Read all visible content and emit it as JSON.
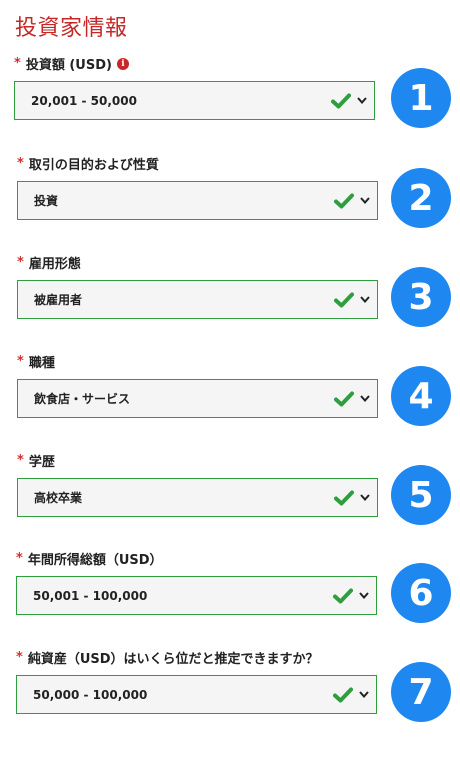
{
  "title": "投資家情報",
  "required_mark": "*",
  "info_glyph": "i",
  "fields": [
    {
      "label": "投資額 (USD)",
      "value": "20,001 - 50,000",
      "step": "1",
      "has_info": true
    },
    {
      "label": "取引の目的および性質",
      "value": "投資",
      "step": "2"
    },
    {
      "label": "雇用形態",
      "value": "被雇用者",
      "step": "3"
    },
    {
      "label": "職種",
      "value": "飲食店・サービス",
      "step": "4"
    },
    {
      "label": "学歴",
      "value": "高校卒業",
      "step": "5"
    },
    {
      "label": "年間所得総額（USD）",
      "value": "50,001 - 100,000",
      "step": "6"
    },
    {
      "label": "純資産（USD）はいくら位だと推定できますか？",
      "value": "50,000 - 100,000",
      "step": "7"
    }
  ],
  "colors": {
    "title": "#c62828",
    "required": "#d32f2f",
    "valid_border": "#2e9e3e",
    "check": "#2e9e3e",
    "step_badge": "#1e88f0"
  },
  "icons": {
    "valid": "check-icon",
    "dropdown": "chevron-down-icon",
    "info": "info-icon"
  }
}
